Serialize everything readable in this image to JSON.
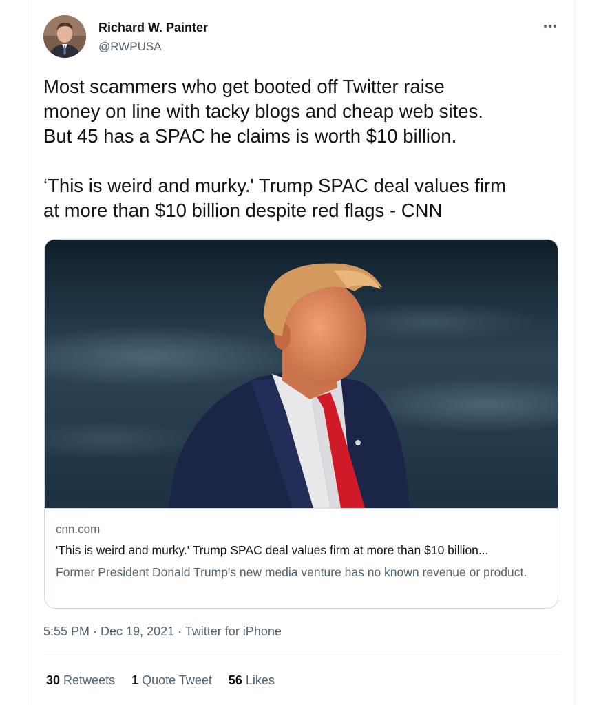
{
  "author": {
    "display_name": "Richard W. Painter",
    "handle": "@RWPUSA",
    "avatar_icon": "profile-photo"
  },
  "more_icon": "ellipsis-icon",
  "tweet": {
    "paragraph1": "Most scammers who get booted off Twitter raise\nmoney on line with tacky blogs and cheap web sites.\nBut 45 has a SPAC he claims is worth $10 billion.",
    "paragraph2": "‘This is weird and murky.' Trump SPAC deal values firm\nat more than $10 billion despite red flags - CNN"
  },
  "link_card": {
    "domain": "cnn.com",
    "title": "'This is weird and murky.' Trump SPAC deal values firm at more than $10 billion...",
    "description": "Former President Donald Trump's new media venture has no known revenue or product."
  },
  "meta": {
    "time": "5:55 PM",
    "separator": " · ",
    "date": "Dec 19, 2021",
    "source": "Twitter for iPhone"
  },
  "stats": {
    "retweets_count": "30",
    "retweets_label": "Retweets",
    "quote_count": "1",
    "quote_label": "Quote Tweet",
    "likes_count": "56",
    "likes_label": "Likes"
  },
  "colors": {
    "primary_text": "#0f1419",
    "secondary_text": "#536471",
    "border": "#cfd9de"
  }
}
